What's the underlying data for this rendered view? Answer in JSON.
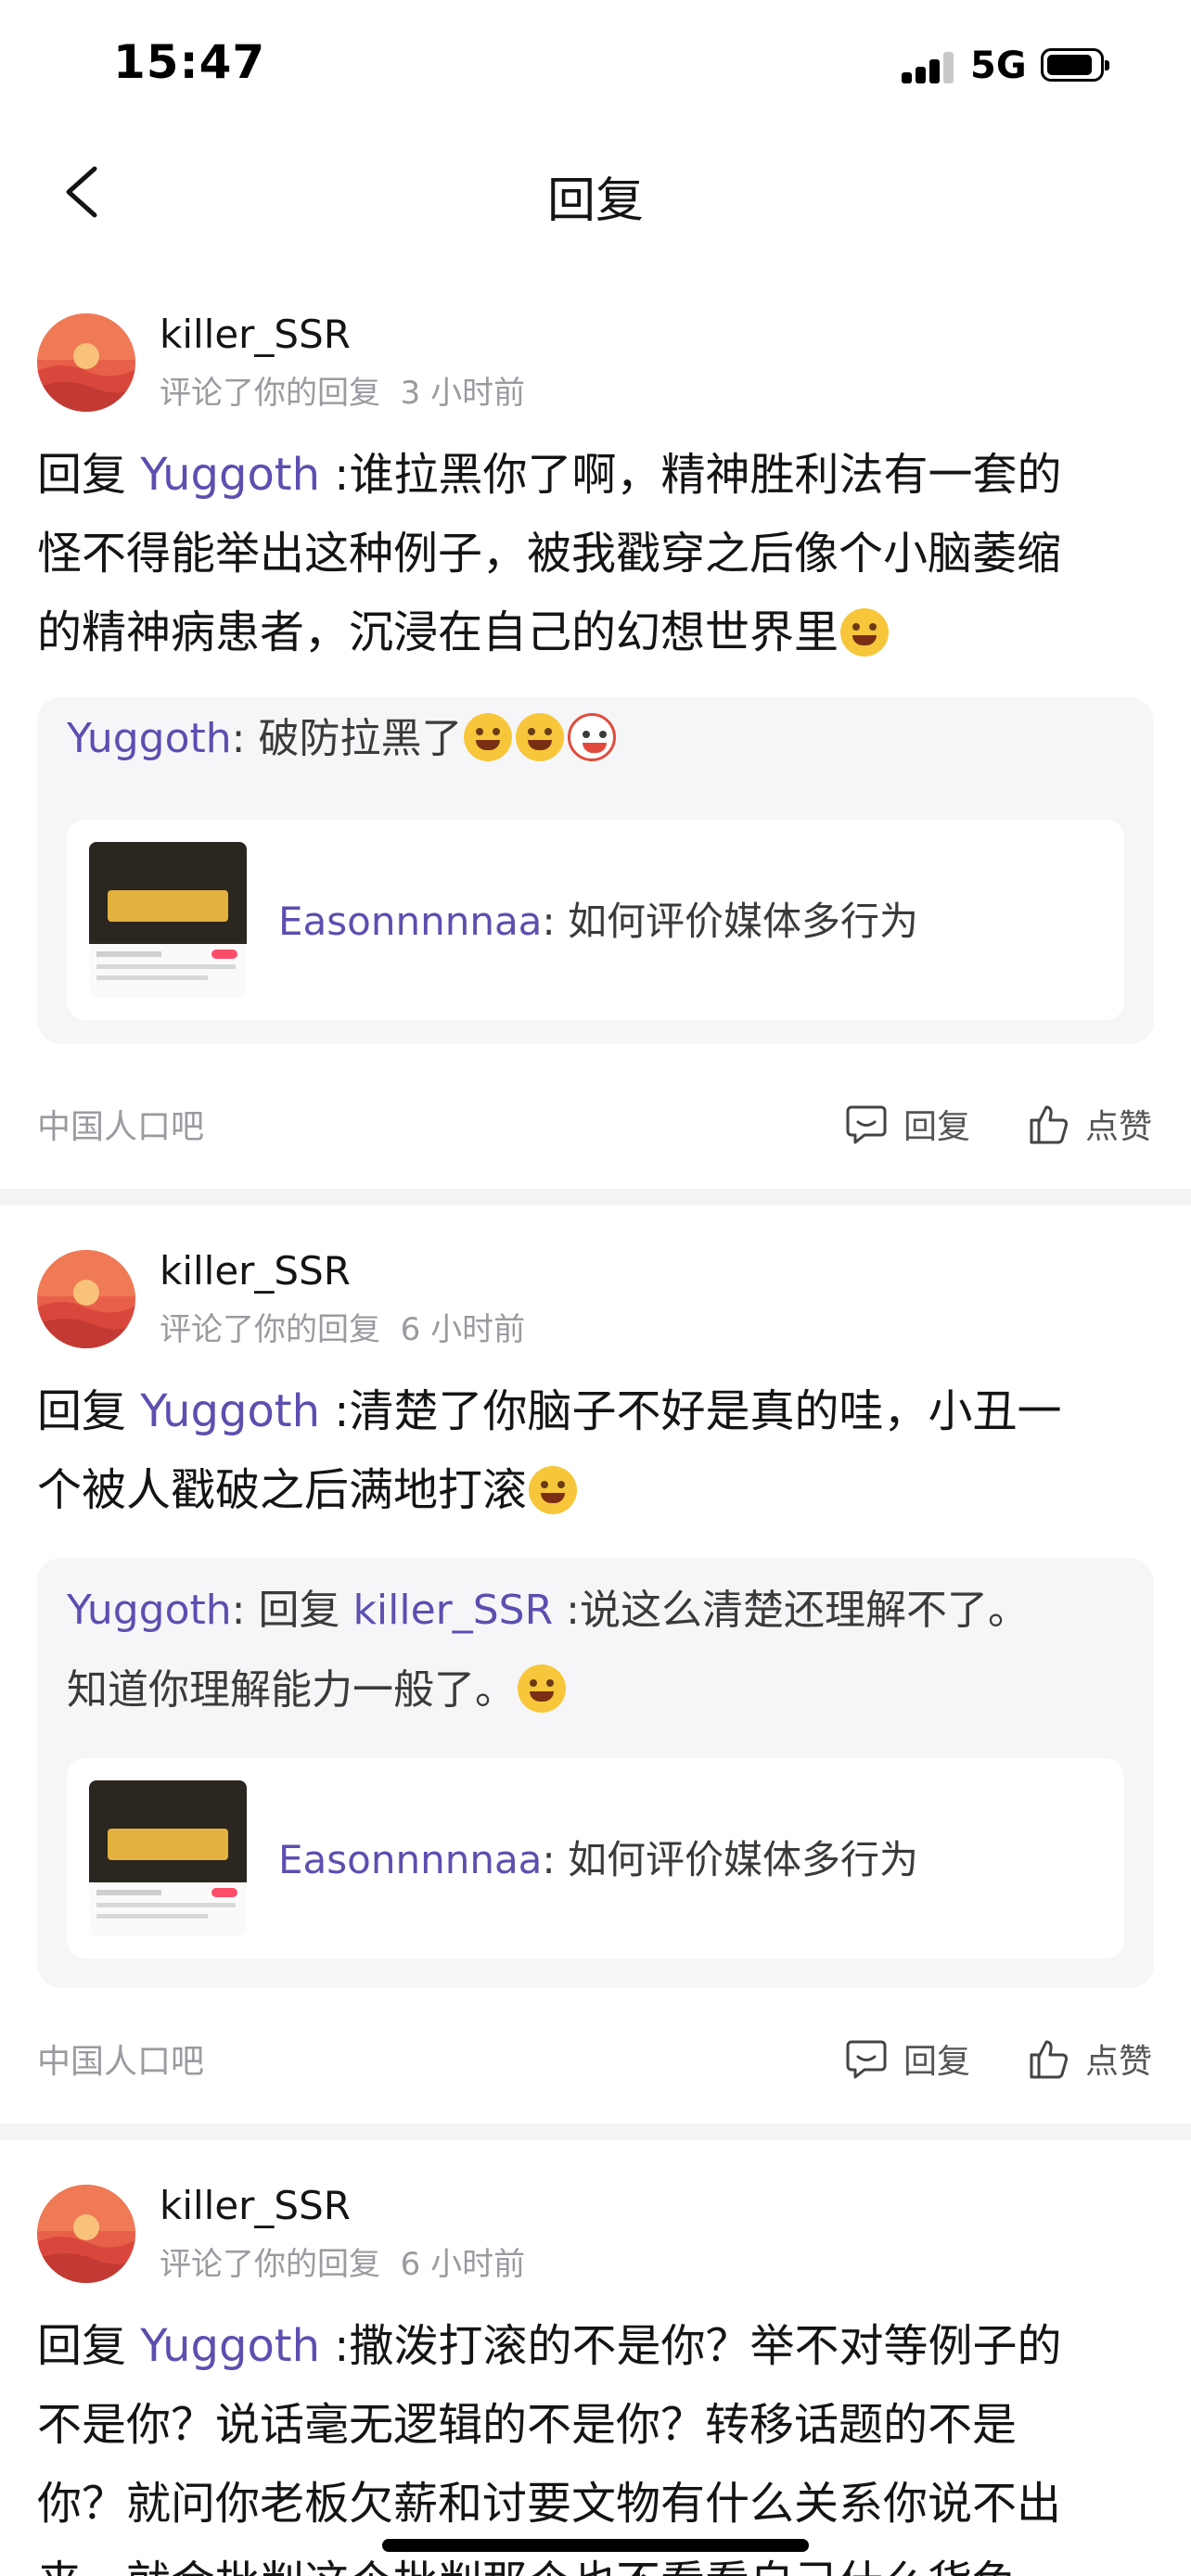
{
  "status_bar": {
    "time": "15:47",
    "network": "5G"
  },
  "nav": {
    "title": "回复"
  },
  "posts": [
    {
      "username": "killer_SSR",
      "action": "评论了你的回复",
      "time": "3 小时前",
      "reply_prefix": "回复 ",
      "reply_to": "Yuggoth",
      "text_line1": " :谁拉黑你了啊，精神胜利法有一套的",
      "text_line2": "怪不得能举出这种例子，被我戳穿之后像个小脑萎缩",
      "text_line3": "的精神病患者，沉浸在自己的幻想世界里",
      "quote_author": "Yuggoth",
      "quote_text": ": 破防拉黑了",
      "ref_author": "Easonnnnnaa",
      "ref_text": ": 如何评价媒体多行为",
      "forum": "中国人口吧",
      "reply_label": "回复",
      "like_label": "点赞"
    },
    {
      "username": "killer_SSR",
      "action": "评论了你的回复",
      "time": "6 小时前",
      "reply_prefix": "回复 ",
      "reply_to": "Yuggoth",
      "text_line1": " :清楚了你脑子不好是真的哇，小丑一",
      "text_line2": "个被人戳破之后满地打滚",
      "quote_author": "Yuggoth",
      "quote_mid": ": 回复 ",
      "quote_reply_to": "killer_SSR",
      "quote_text": " :说这么清楚还理解不了。",
      "quote_text2": "知道你理解能力一般了。",
      "ref_author": "Easonnnnnaa",
      "ref_text": ": 如何评价媒体多行为",
      "forum": "中国人口吧",
      "reply_label": "回复",
      "like_label": "点赞"
    },
    {
      "username": "killer_SSR",
      "action": "评论了你的回复",
      "time": "6 小时前",
      "reply_prefix": "回复 ",
      "reply_to": "Yuggoth",
      "text_line1": " :撒泼打滚的不是你？举不对等例子的",
      "text_line2": "不是你？说话毫无逻辑的不是你？转移话题的不是",
      "text_line3": "你？就问你老板欠薪和讨要文物有什么关系你说不出",
      "text_line4": "来，就会批判这个批判那个也不看看自己什么货色"
    }
  ],
  "colors": {
    "link": "#5b4fb0",
    "meta": "#9a9aa0",
    "quote_bg": "#f6f6f9",
    "divider": "#f4f4f7"
  },
  "icons": [
    "back-icon",
    "comment-icon",
    "thumbs-up-icon",
    "avatar-sunset"
  ]
}
